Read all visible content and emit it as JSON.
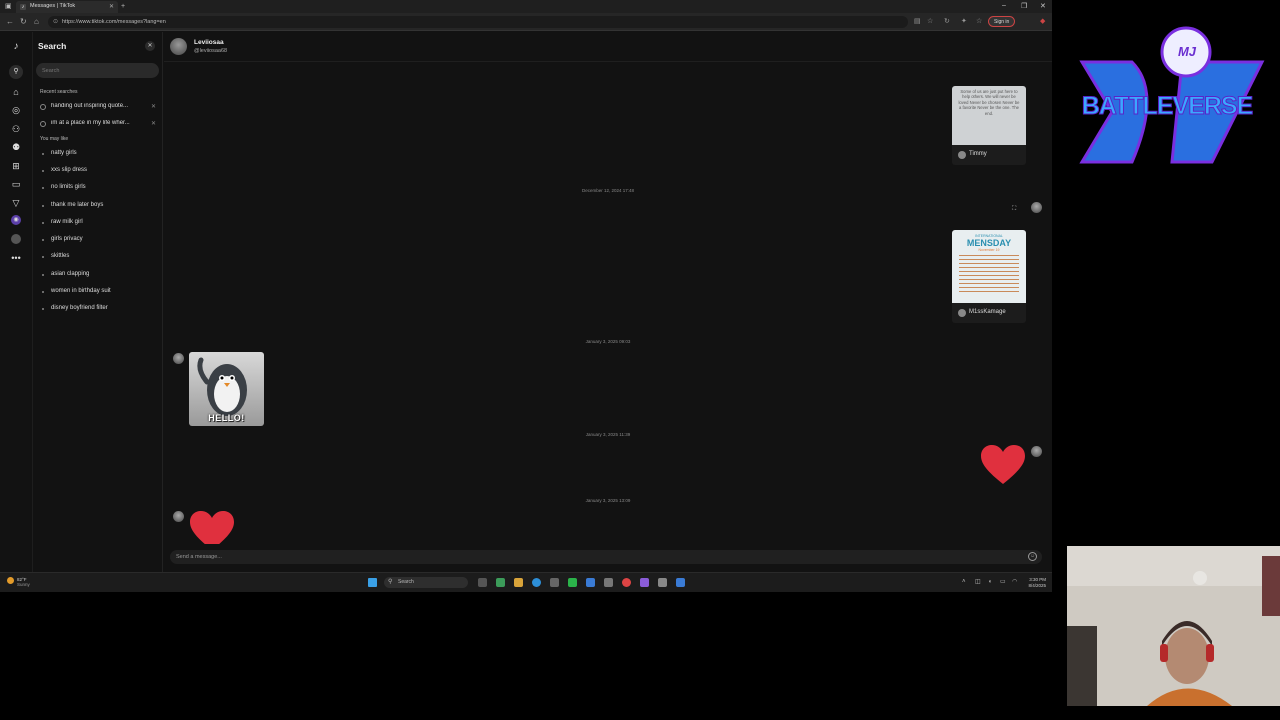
{
  "browser": {
    "tab_title": "Messages | TikTok",
    "url": "https://www.tiktok.com/messages?lang=en",
    "sign_in_label": "Sign in"
  },
  "search_panel": {
    "title": "Search",
    "input_placeholder": "Search",
    "recent_heading": "Recent searches",
    "recent": [
      "handing out inspiring quote...",
      "im at a place in my life wher..."
    ],
    "suggest_heading": "You may like",
    "suggestions": [
      "natty girls",
      "xxs slip dress",
      "no limits girls",
      "thank me later boys",
      "raw milk girl",
      "girls privacy",
      "skittles",
      "asian clapping",
      "women in birthday suit",
      "disney boyfriend filter"
    ]
  },
  "chat": {
    "name": "Leviiosaa",
    "handle": "@leviiosaa68",
    "timestamps": [
      "December 12, 2024 17:48",
      "January 3, 2025 09:03",
      "January 3, 2025 11:39",
      "January 3, 2025 13:09"
    ],
    "share1": {
      "text": "Some of us are just put here to help others. We will never be loved Never be chosen Never be a favorite Never be the one. The end.",
      "author": "Timmy"
    },
    "share2": {
      "thumb_line1": "INTERNATIONAL",
      "thumb_line2": "MENSDAY",
      "thumb_line3": "November 19",
      "author": "M1ssKamage"
    },
    "sticker_label": "HELLO!",
    "send_placeholder": "Send a message..."
  },
  "taskbar": {
    "weather_temp": "82°F",
    "weather_desc": "Sunny",
    "search_label": "Search",
    "time": "3:30 PM",
    "date": "8/4/2025"
  },
  "overlay": {
    "logo_text": "BATTLEVERSE",
    "logo_badge": "MJ",
    "logo_letters": "DV"
  },
  "colors": {
    "heart": "#e0303e",
    "logo_blue": "#1a8cff",
    "logo_purple": "#7a2fe0"
  }
}
